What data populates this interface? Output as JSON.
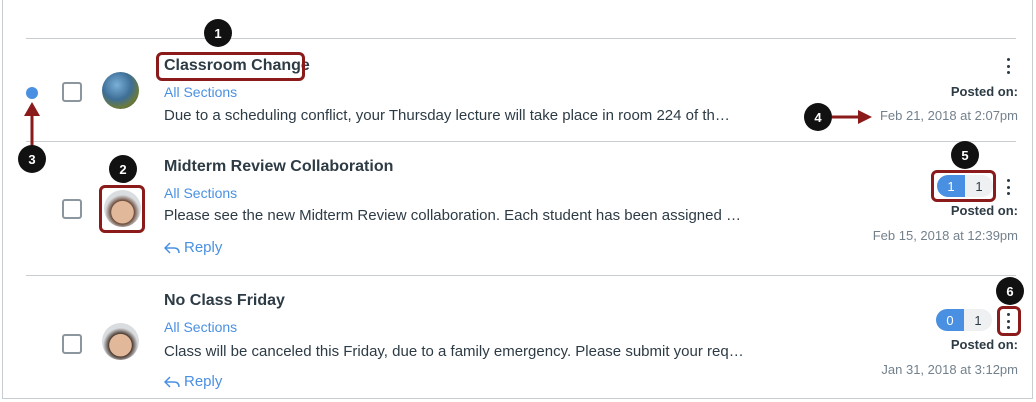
{
  "discussions": [
    {
      "title": "Classroom Change",
      "sections": "All Sections",
      "excerpt": "Due to a scheduling conflict, your Thursday lecture will take place in room 224 of th…",
      "posted_label": "Posted on:",
      "posted_date": "Feb 21, 2018 at 2:07pm",
      "unread": true
    },
    {
      "title": "Midterm Review Collaboration",
      "sections": "All Sections",
      "excerpt": "Please see the new Midterm Review collaboration. Each student has been assigned …",
      "reply": "Reply",
      "unread_count": "1",
      "total_count": "1",
      "posted_label": "Posted on:",
      "posted_date": "Feb 15, 2018 at 12:39pm"
    },
    {
      "title": "No Class Friday",
      "sections": "All Sections",
      "excerpt": "Class will be canceled this Friday, due to a family emergency. Please submit your req…",
      "reply": "Reply",
      "unread_count": "0",
      "total_count": "1",
      "posted_label": "Posted on:",
      "posted_date": "Jan 31, 2018 at 3:12pm"
    }
  ],
  "callouts": [
    "1",
    "2",
    "3",
    "4",
    "5",
    "6"
  ],
  "colors": {
    "accent": "#4a90e2",
    "highlight": "#8b1a1a",
    "callout": "#111111"
  },
  "icons": {
    "reply": "reply-arrow-icon",
    "menu": "kebab-menu-icon"
  }
}
